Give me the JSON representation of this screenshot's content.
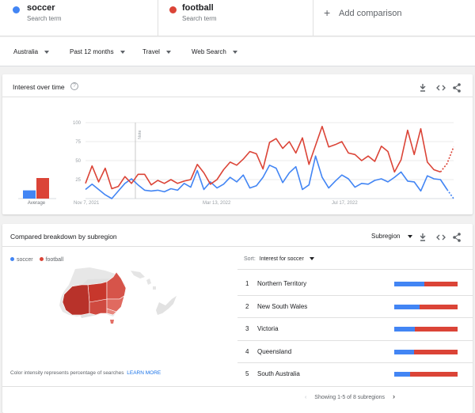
{
  "terms": [
    {
      "name": "soccer",
      "sub": "Search term",
      "color": "#4285f4"
    },
    {
      "name": "football",
      "sub": "Search term",
      "color": "#db4437"
    }
  ],
  "add_comparison": "Add comparison",
  "filters": [
    "Australia",
    "Past 12 months",
    "Travel",
    "Web Search"
  ],
  "interest": {
    "title": "Interest over time",
    "average_label": "Average",
    "note_label": "Note"
  },
  "breakdown": {
    "title": "Compared breakdown by subregion",
    "scope": "Subregion",
    "sort_prefix": "Sort:",
    "sort_value": "Interest for soccer",
    "legend": [
      "soccer",
      "football"
    ],
    "color_note": "Color intensity represents percentage of searches",
    "learn_more": "LEARN MORE",
    "pager": "Showing 1-5 of 8 subregions",
    "regions": [
      {
        "rank": "1",
        "name": "Northern Territory",
        "soccer": 47,
        "football": 53
      },
      {
        "rank": "2",
        "name": "New South Wales",
        "soccer": 40,
        "football": 60
      },
      {
        "rank": "3",
        "name": "Victoria",
        "soccer": 33,
        "football": 67
      },
      {
        "rank": "4",
        "name": "Queensland",
        "soccer": 31,
        "football": 69
      },
      {
        "rank": "5",
        "name": "South Australia",
        "soccer": 25,
        "football": 75
      }
    ]
  },
  "chart_data": {
    "type": "line",
    "ylim": [
      0,
      100
    ],
    "yticks": [
      "100",
      "75",
      "50",
      "25"
    ],
    "xtick_labels": [
      "Nov 7, 2021",
      "Mar 13, 2022",
      "Jul 17, 2022"
    ],
    "averages": {
      "soccer": 20,
      "football": 50
    },
    "series": [
      {
        "name": "soccer",
        "color": "#4285f4",
        "values": [
          12,
          19,
          12,
          5,
          0,
          10,
          20,
          26,
          18,
          11,
          10,
          11,
          9,
          13,
          11,
          20,
          15,
          37,
          12,
          22,
          14,
          19,
          28,
          22,
          31,
          14,
          17,
          28,
          44,
          40,
          21,
          34,
          42,
          12,
          18,
          56,
          28,
          14,
          23,
          31,
          26,
          15,
          20,
          19,
          24,
          26,
          22,
          28,
          35,
          23,
          22,
          10,
          30,
          26,
          25,
          12,
          0
        ],
        "projected_from": 55
      },
      {
        "name": "football",
        "color": "#db4437",
        "values": [
          20,
          43,
          22,
          40,
          13,
          16,
          29,
          20,
          32,
          32,
          18,
          24,
          20,
          25,
          20,
          23,
          25,
          45,
          34,
          19,
          25,
          38,
          48,
          44,
          52,
          62,
          59,
          39,
          74,
          79,
          66,
          75,
          60,
          80,
          45,
          70,
          95,
          68,
          71,
          75,
          60,
          58,
          50,
          56,
          49,
          69,
          62,
          35,
          51,
          90,
          58,
          92,
          48,
          38,
          35,
          46,
          68
        ],
        "projected_from": 54
      }
    ]
  },
  "colors": {
    "accent": "#4285f4",
    "red": "#db4437",
    "link": "#1a73e8"
  }
}
